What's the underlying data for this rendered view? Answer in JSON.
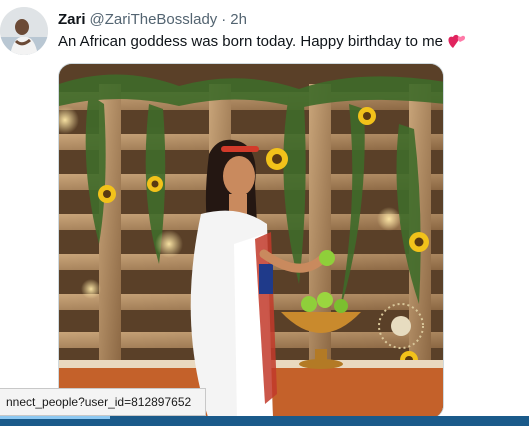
{
  "tweet": {
    "display_name": "Zari",
    "handle": "@ZariTheBosslady",
    "separator": "·",
    "time": "2h",
    "text": "An African goddess was born today. Happy birthday to me",
    "emoji": "revolving-hearts-icon"
  },
  "status_bar": {
    "url_text": "nnect_people?user_id=812897652"
  },
  "colors": {
    "text_primary": "#0f1419",
    "text_secondary": "#536471",
    "media_border": "#cfd9de",
    "taskbar": "#1a5a8a"
  }
}
